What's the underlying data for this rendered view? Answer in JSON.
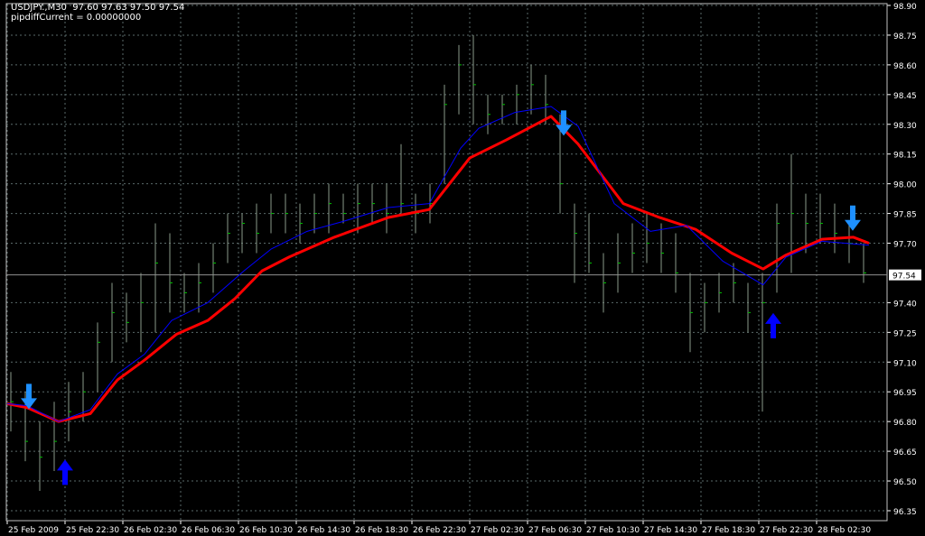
{
  "header": {
    "symbol_line": "USDJPY.,M30  97.60 97.63 97.50 97.54",
    "indicator_line": "pipdiffCurrent = 0.00000000"
  },
  "colors": {
    "background": "#000000",
    "grid": "#5a6a6a",
    "bars": "#00c000",
    "bar_wicks": "#8a9a8a",
    "fast_ma": "#0000ff",
    "slow_ma": "#ff0000",
    "sell_arrow": "#1e90ff",
    "buy_arrow": "#0000ff",
    "axis_text": "#ffffff"
  },
  "chart_data": {
    "type": "line",
    "title": "USDJPY.,M30",
    "current_price": "97.54",
    "ylim": [
      96.35,
      98.9
    ],
    "y_ticks": [
      "98.90",
      "98.75",
      "98.60",
      "98.45",
      "98.30",
      "98.15",
      "98.00",
      "97.85",
      "97.70",
      "97.40",
      "97.25",
      "97.10",
      "96.95",
      "96.80",
      "96.65",
      "96.50",
      "96.35"
    ],
    "x_unit": "bar index (30 min)",
    "x_ticks": [
      {
        "bar": 0,
        "label": "25 Feb 2009"
      },
      {
        "bar": 8,
        "label": "25 Feb 22:30"
      },
      {
        "bar": 16,
        "label": "26 Feb 02:30"
      },
      {
        "bar": 24,
        "label": "26 Feb 06:30"
      },
      {
        "bar": 32,
        "label": "26 Feb 10:30"
      },
      {
        "bar": 40,
        "label": "26 Feb 14:30"
      },
      {
        "bar": 48,
        "label": "26 Feb 18:30"
      },
      {
        "bar": 56,
        "label": "26 Feb 22:30"
      },
      {
        "bar": 64,
        "label": "27 Feb 02:30"
      },
      {
        "bar": 72,
        "label": "27 Feb 06:30"
      },
      {
        "bar": 80,
        "label": "27 Feb 10:30"
      },
      {
        "bar": 88,
        "label": "27 Feb 14:30"
      },
      {
        "bar": 96,
        "label": "27 Feb 18:30"
      },
      {
        "bar": 104,
        "label": "27 Feb 22:30"
      },
      {
        "bar": 112,
        "label": "28 Feb 02:30"
      }
    ],
    "bars_hlc": [
      [
        97.05,
        96.75,
        96.9
      ],
      [
        96.95,
        96.6,
        96.7
      ],
      [
        96.8,
        96.45,
        96.62
      ],
      [
        96.9,
        96.55,
        96.7
      ],
      [
        97.0,
        96.7,
        96.85
      ],
      [
        97.05,
        96.8,
        96.95
      ],
      [
        97.3,
        96.95,
        97.2
      ],
      [
        97.5,
        97.1,
        97.35
      ],
      [
        97.45,
        97.2,
        97.3
      ],
      [
        97.55,
        97.15,
        97.4
      ],
      [
        97.8,
        97.25,
        97.6
      ],
      [
        97.75,
        97.35,
        97.5
      ],
      [
        97.55,
        97.35,
        97.45
      ],
      [
        97.6,
        97.35,
        97.5
      ],
      [
        97.7,
        97.45,
        97.6
      ],
      [
        97.85,
        97.6,
        97.75
      ],
      [
        97.85,
        97.65,
        97.8
      ],
      [
        97.9,
        97.65,
        97.75
      ],
      [
        97.95,
        97.75,
        97.85
      ],
      [
        97.95,
        97.75,
        97.85
      ],
      [
        97.9,
        97.7,
        97.8
      ],
      [
        97.95,
        97.75,
        97.85
      ],
      [
        98.0,
        97.75,
        97.9
      ],
      [
        97.95,
        97.8,
        97.85
      ],
      [
        98.0,
        97.75,
        97.9
      ],
      [
        98.0,
        97.8,
        97.9
      ],
      [
        98.0,
        97.75,
        97.85
      ],
      [
        98.2,
        97.85,
        97.9
      ],
      [
        97.95,
        97.75,
        97.85
      ],
      [
        98.0,
        97.8,
        97.9
      ],
      [
        98.5,
        98.0,
        98.4
      ],
      [
        98.7,
        98.35,
        98.6
      ],
      [
        98.75,
        98.3,
        98.5
      ],
      [
        98.45,
        98.25,
        98.35
      ],
      [
        98.45,
        98.3,
        98.4
      ],
      [
        98.5,
        98.3,
        98.45
      ],
      [
        98.6,
        98.35,
        98.5
      ],
      [
        98.55,
        98.3,
        98.4
      ],
      [
        98.35,
        97.85,
        98.0
      ],
      [
        97.9,
        97.5,
        97.75
      ],
      [
        97.85,
        97.55,
        97.6
      ],
      [
        97.65,
        97.35,
        97.5
      ],
      [
        97.75,
        97.45,
        97.6
      ],
      [
        97.8,
        97.55,
        97.65
      ],
      [
        97.85,
        97.6,
        97.7
      ],
      [
        97.8,
        97.55,
        97.65
      ],
      [
        97.75,
        97.45,
        97.55
      ],
      [
        97.55,
        97.15,
        97.35
      ],
      [
        97.5,
        97.25,
        97.4
      ],
      [
        97.55,
        97.35,
        97.45
      ],
      [
        97.6,
        97.4,
        97.5
      ],
      [
        97.5,
        97.25,
        97.35
      ],
      [
        97.55,
        96.85,
        97.4
      ],
      [
        97.9,
        97.45,
        97.8
      ],
      [
        98.15,
        97.55,
        97.85
      ],
      [
        97.95,
        97.65,
        97.8
      ],
      [
        97.95,
        97.7,
        97.8
      ],
      [
        97.9,
        97.65,
        97.75
      ],
      [
        97.8,
        97.6,
        97.7
      ],
      [
        97.7,
        97.5,
        97.55
      ]
    ],
    "series": [
      {
        "name": "slow MA",
        "x": [
          0,
          2.75,
          7.1,
          11.5,
          15.25,
          19,
          23.4,
          27.75,
          31.5,
          35.25,
          39,
          45.25,
          52.75,
          58.4,
          64,
          69,
          75.25,
          79,
          85.25,
          90.25,
          95.25,
          100.25,
          104.6,
          107.75,
          112.75,
          117.1,
          119.25
        ],
        "values": [
          96.89,
          96.87,
          96.8,
          96.84,
          97.01,
          97.11,
          97.24,
          97.31,
          97.42,
          97.56,
          97.63,
          97.73,
          97.83,
          97.87,
          98.13,
          98.22,
          98.34,
          98.2,
          97.9,
          97.83,
          97.77,
          97.65,
          97.57,
          97.64,
          97.72,
          97.73,
          97.7
        ]
      },
      {
        "name": "fast MA",
        "x": [
          0,
          2.75,
          7.1,
          11.5,
          15.25,
          19,
          22.75,
          27.75,
          32.75,
          36.5,
          41.5,
          46.5,
          52.75,
          58.4,
          62.75,
          65.25,
          70.25,
          75.25,
          79,
          84,
          89,
          94,
          99,
          104.6,
          107.75,
          112.75,
          119.25
        ],
        "values": [
          96.89,
          96.88,
          96.8,
          96.86,
          97.04,
          97.14,
          97.31,
          97.4,
          97.56,
          97.67,
          97.76,
          97.81,
          97.88,
          97.9,
          98.18,
          98.28,
          98.36,
          98.39,
          98.29,
          97.9,
          97.76,
          97.79,
          97.61,
          97.49,
          97.63,
          97.71,
          97.69
        ]
      }
    ],
    "signals": [
      {
        "type": "sell",
        "bar": 3,
        "price": 96.99
      },
      {
        "type": "buy",
        "bar": 8,
        "price": 96.48
      },
      {
        "type": "sell",
        "bar": 77,
        "price": 98.37
      },
      {
        "type": "buy",
        "bar": 106,
        "price": 97.22
      },
      {
        "type": "sell",
        "bar": 117,
        "price": 97.89
      }
    ]
  }
}
